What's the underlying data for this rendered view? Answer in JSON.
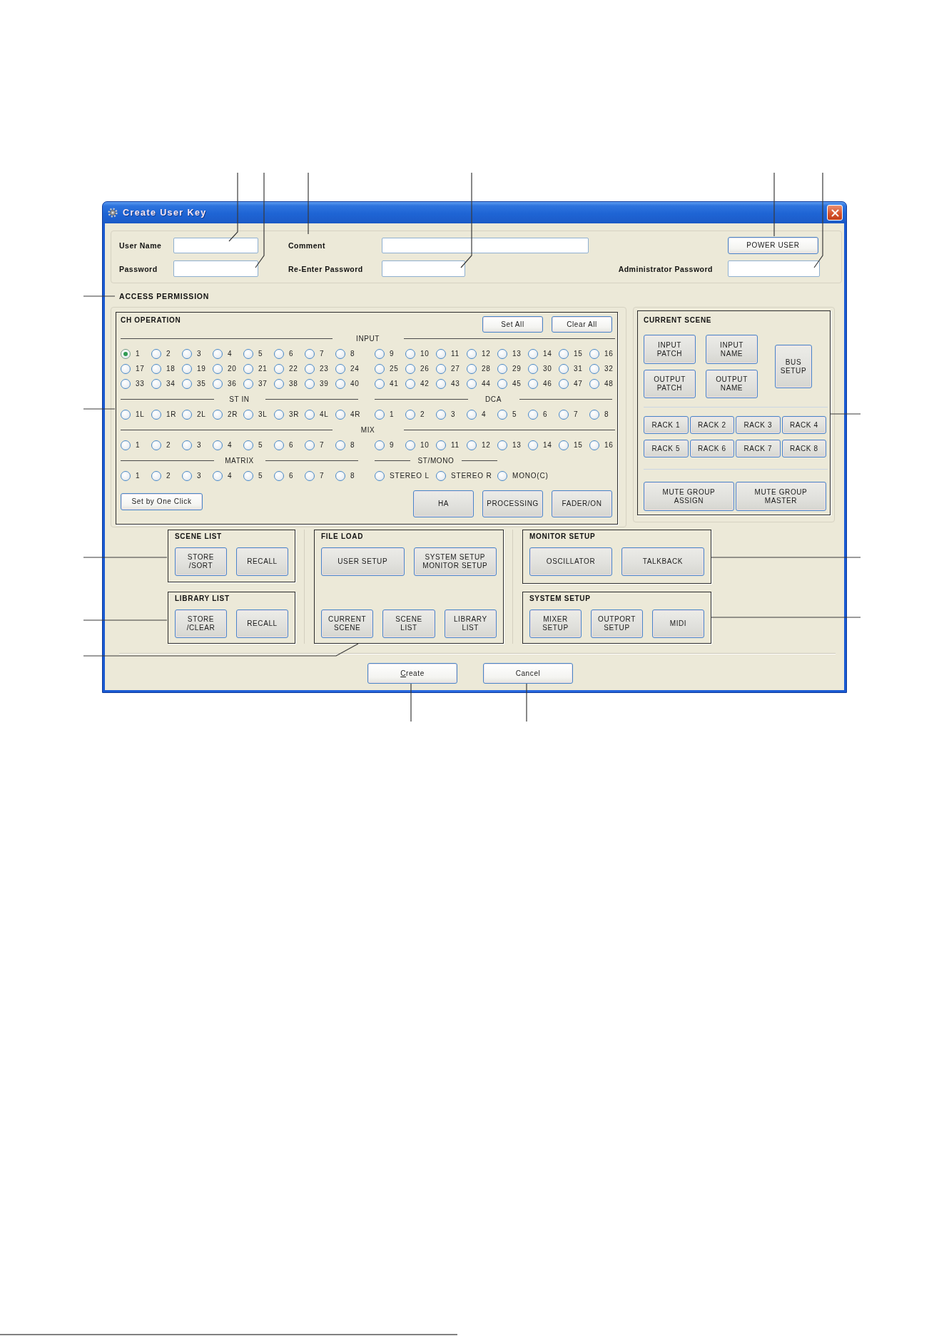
{
  "window": {
    "title": "Create User Key"
  },
  "account": {
    "rows": [
      {
        "items": [
          {
            "kind": "field",
            "label": "User Name",
            "wide": false
          },
          {
            "kind": "field",
            "label": "Comment",
            "wide": true
          },
          {
            "kind": "button",
            "label": "POWER USER"
          }
        ]
      },
      {
        "items": [
          {
            "kind": "field",
            "label": "Password",
            "wide": false
          },
          {
            "kind": "field",
            "label": "Re-Enter Password",
            "wide": false
          },
          {
            "kind": "field",
            "label": "Administrator Password",
            "wide": false
          }
        ]
      }
    ]
  },
  "access_permission": {
    "title": "ACCESS PERMISSION"
  },
  "ch_operation": {
    "title": "CH OPERATION",
    "actions": [
      "Set All",
      "Clear All"
    ],
    "bands": [
      {
        "groups": [
          {
            "title": "INPUT",
            "kind": "numbered",
            "channels": [
              {
                "label": "1",
                "selected": true
              },
              {
                "label": "2",
                "selected": false
              },
              {
                "label": "3",
                "selected": false
              },
              {
                "label": "4",
                "selected": false
              },
              {
                "label": "5",
                "selected": false
              },
              {
                "label": "6",
                "selected": false
              },
              {
                "label": "7",
                "selected": false
              },
              {
                "label": "8",
                "selected": false
              },
              {
                "label": "9",
                "selected": false
              },
              {
                "label": "10",
                "selected": false
              },
              {
                "label": "11",
                "selected": false
              },
              {
                "label": "12",
                "selected": false
              },
              {
                "label": "13",
                "selected": false
              },
              {
                "label": "14",
                "selected": false
              },
              {
                "label": "15",
                "selected": false
              },
              {
                "label": "16",
                "selected": false
              },
              {
                "label": "17",
                "selected": false
              },
              {
                "label": "18",
                "selected": false
              },
              {
                "label": "19",
                "selected": false
              },
              {
                "label": "20",
                "selected": false
              },
              {
                "label": "21",
                "selected": false
              },
              {
                "label": "22",
                "selected": false
              },
              {
                "label": "23",
                "selected": false
              },
              {
                "label": "24",
                "selected": false
              },
              {
                "label": "25",
                "selected": false
              },
              {
                "label": "26",
                "selected": false
              },
              {
                "label": "27",
                "selected": false
              },
              {
                "label": "28",
                "selected": false
              },
              {
                "label": "29",
                "selected": false
              },
              {
                "label": "30",
                "selected": false
              },
              {
                "label": "31",
                "selected": false
              },
              {
                "label": "32",
                "selected": false
              },
              {
                "label": "33",
                "selected": false
              },
              {
                "label": "34",
                "selected": false
              },
              {
                "label": "35",
                "selected": false
              },
              {
                "label": "36",
                "selected": false
              },
              {
                "label": "37",
                "selected": false
              },
              {
                "label": "38",
                "selected": false
              },
              {
                "label": "39",
                "selected": false
              },
              {
                "label": "40",
                "selected": false
              },
              {
                "label": "41",
                "selected": false
              },
              {
                "label": "42",
                "selected": false
              },
              {
                "label": "43",
                "selected": false
              },
              {
                "label": "44",
                "selected": false
              },
              {
                "label": "45",
                "selected": false
              },
              {
                "label": "46",
                "selected": false
              },
              {
                "label": "47",
                "selected": false
              },
              {
                "label": "48",
                "selected": false
              }
            ]
          }
        ]
      },
      {
        "groups": [
          {
            "title": "ST IN",
            "kind": "numbered",
            "channels": [
              {
                "label": "1L",
                "selected": false
              },
              {
                "label": "1R",
                "selected": false
              },
              {
                "label": "2L",
                "selected": false
              },
              {
                "label": "2R",
                "selected": false
              },
              {
                "label": "3L",
                "selected": false
              },
              {
                "label": "3R",
                "selected": false
              },
              {
                "label": "4L",
                "selected": false
              },
              {
                "label": "4R",
                "selected": false
              }
            ]
          },
          {
            "title": "DCA",
            "kind": "numbered",
            "channels": [
              {
                "label": "1",
                "selected": false
              },
              {
                "label": "2",
                "selected": false
              },
              {
                "label": "3",
                "selected": false
              },
              {
                "label": "4",
                "selected": false
              },
              {
                "label": "5",
                "selected": false
              },
              {
                "label": "6",
                "selected": false
              },
              {
                "label": "7",
                "selected": false
              },
              {
                "label": "8",
                "selected": false
              }
            ]
          }
        ]
      },
      {
        "groups": [
          {
            "title": "MIX",
            "kind": "numbered",
            "channels": [
              {
                "label": "1",
                "selected": false
              },
              {
                "label": "2",
                "selected": false
              },
              {
                "label": "3",
                "selected": false
              },
              {
                "label": "4",
                "selected": false
              },
              {
                "label": "5",
                "selected": false
              },
              {
                "label": "6",
                "selected": false
              },
              {
                "label": "7",
                "selected": false
              },
              {
                "label": "8",
                "selected": false
              },
              {
                "label": "9",
                "selected": false
              },
              {
                "label": "10",
                "selected": false
              },
              {
                "label": "11",
                "selected": false
              },
              {
                "label": "12",
                "selected": false
              },
              {
                "label": "13",
                "selected": false
              },
              {
                "label": "14",
                "selected": false
              },
              {
                "label": "15",
                "selected": false
              },
              {
                "label": "16",
                "selected": false
              }
            ]
          }
        ]
      },
      {
        "groups": [
          {
            "title": "MATRIX",
            "kind": "numbered",
            "channels": [
              {
                "label": "1",
                "selected": false
              },
              {
                "label": "2",
                "selected": false
              },
              {
                "label": "3",
                "selected": false
              },
              {
                "label": "4",
                "selected": false
              },
              {
                "label": "5",
                "selected": false
              },
              {
                "label": "6",
                "selected": false
              },
              {
                "label": "7",
                "selected": false
              },
              {
                "label": "8",
                "selected": false
              }
            ]
          },
          {
            "title": "ST/MONO",
            "kind": "named",
            "channels": [
              {
                "label": "STEREO L",
                "selected": false
              },
              {
                "label": "STEREO R",
                "selected": false
              },
              {
                "label": "MONO(C)",
                "selected": false
              }
            ]
          }
        ]
      }
    ],
    "set_by_one_click": "Set by One Click",
    "category_buttons": [
      "HA",
      "PROCESSING",
      "FADER/ON"
    ]
  },
  "current_scene": {
    "title": "CURRENT SCENE",
    "patch_buttons": [
      "INPUT\nPATCH",
      "INPUT\nNAME",
      "OUTPUT\nPATCH",
      "OUTPUT\nNAME"
    ],
    "bus_button": "BUS\nSETUP",
    "rack_buttons": [
      "RACK 1",
      "RACK 2",
      "RACK 3",
      "RACK 4",
      "RACK 5",
      "RACK 6",
      "RACK 7",
      "RACK 8"
    ],
    "mute_buttons": [
      "MUTE GROUP\nASSIGN",
      "MUTE GROUP\nMASTER"
    ]
  },
  "scene_list": {
    "title": "SCENE LIST",
    "rows": [
      {
        "buttons": [
          "STORE\n/SORT",
          "RECALL"
        ]
      }
    ]
  },
  "library_list": {
    "title": "LIBRARY LIST",
    "rows": [
      {
        "buttons": [
          "STORE\n/CLEAR",
          "RECALL"
        ]
      }
    ]
  },
  "file_load": {
    "title": "FILE LOAD",
    "rows": [
      {
        "buttons": [
          "USER SETUP",
          "SYSTEM SETUP\nMONITOR SETUP"
        ]
      },
      {
        "buttons": [
          "CURRENT\nSCENE",
          "SCENE\nLIST",
          "LIBRARY\nLIST"
        ]
      }
    ]
  },
  "monitor_setup": {
    "title": "MONITOR SETUP",
    "rows": [
      {
        "buttons": [
          "OSCILLATOR",
          "TALKBACK"
        ]
      }
    ]
  },
  "system_setup": {
    "title": "SYSTEM SETUP",
    "rows": [
      {
        "buttons": [
          "MIXER\nSETUP",
          "OUTPORT\nSETUP",
          "MIDI"
        ]
      }
    ]
  },
  "dialog_buttons": [
    {
      "label": "Create",
      "underline_first": true
    },
    {
      "label": "Cancel",
      "underline_first": false
    }
  ]
}
